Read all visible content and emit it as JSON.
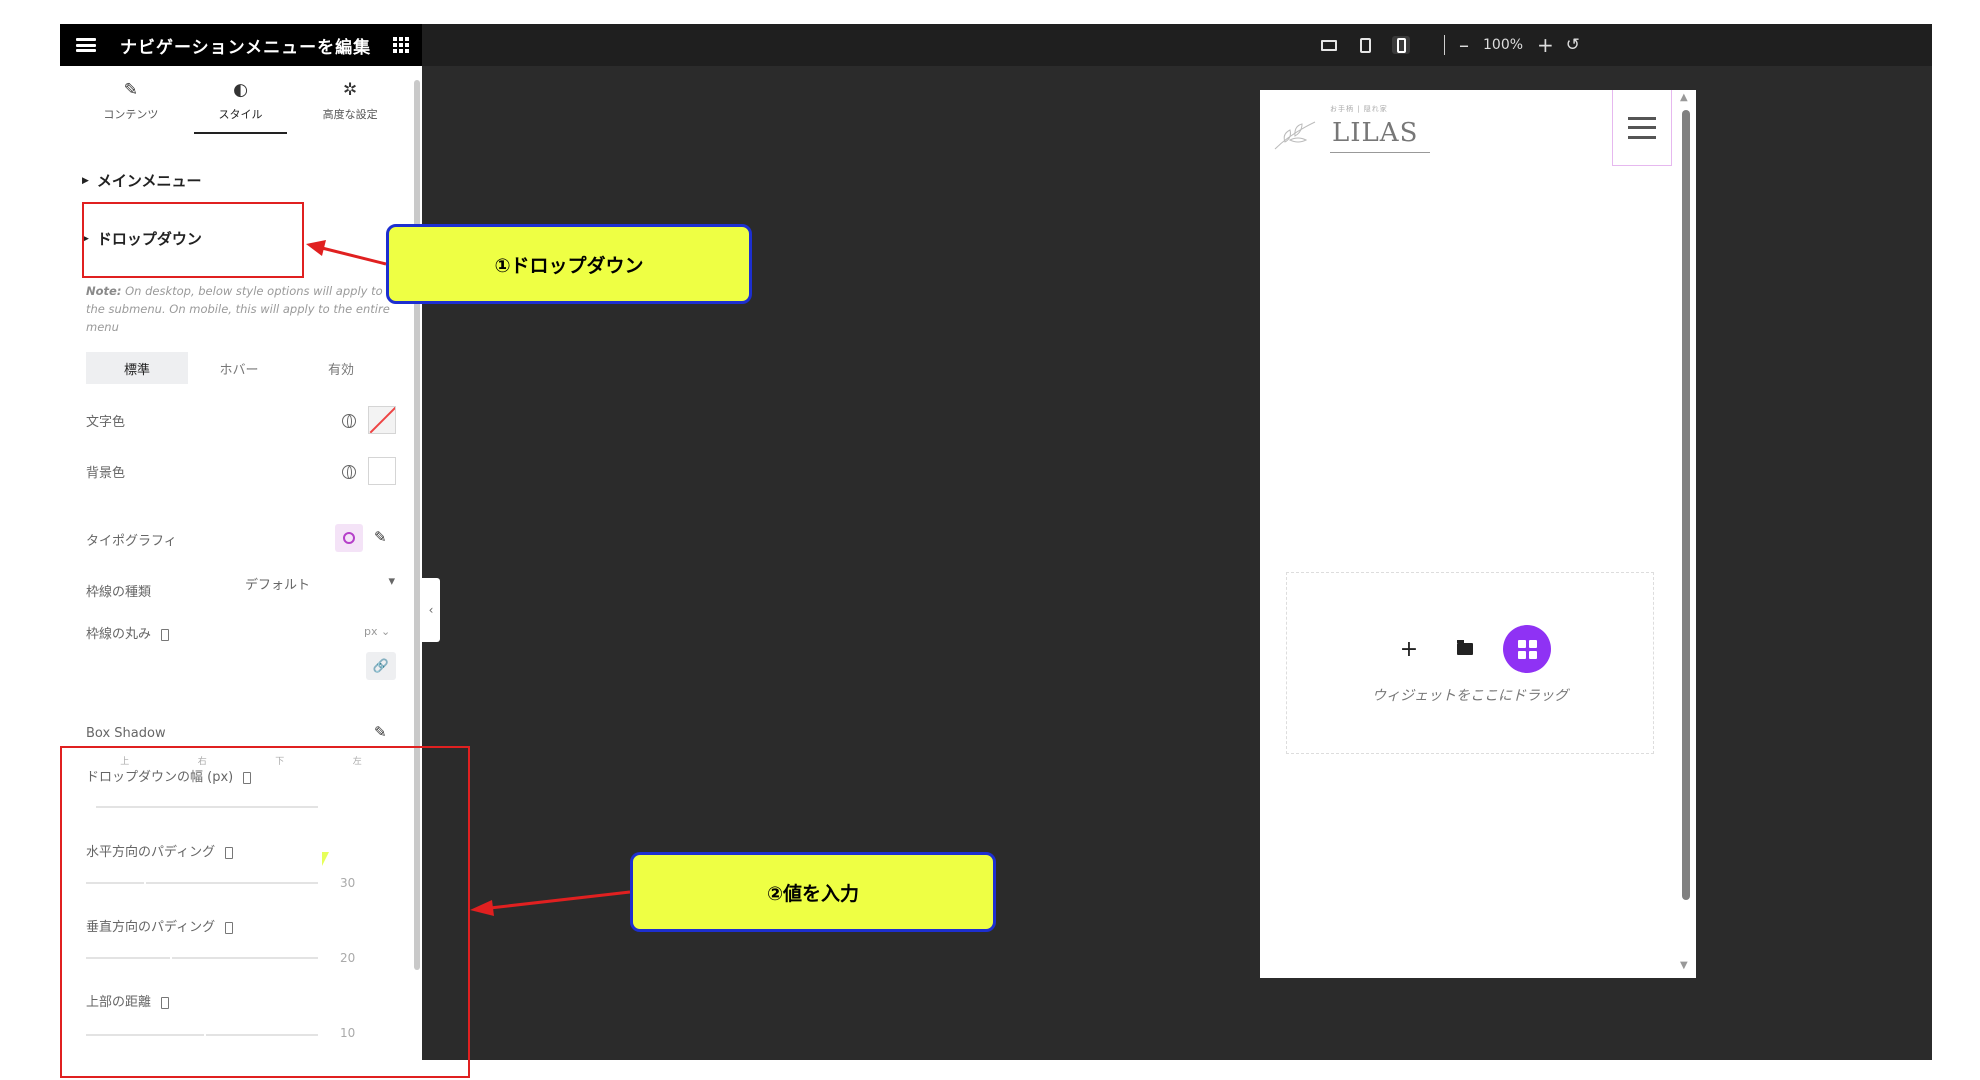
{
  "topbar": {
    "title": "ナビゲーションメニューを編集",
    "zoom_minus": "–",
    "zoom_value": "100%",
    "zoom_plus": "+",
    "reset_icon": "↺"
  },
  "panel": {
    "tabs": [
      {
        "icon": "✎",
        "label": "コンテンツ"
      },
      {
        "icon": "◐",
        "label": "スタイル"
      },
      {
        "icon": "✲",
        "label": "高度な設定"
      }
    ],
    "section_main_menu": "メインメニュー",
    "section_dropdown": "ドロップダウン",
    "note_label": "Note:",
    "note_text": " On desktop, below style options will apply to the submenu. On mobile, this will apply to the entire menu",
    "state_tabs": [
      "標準",
      "ホバー",
      "有効"
    ],
    "text_color_label": "文字色",
    "bg_color_label": "背景色",
    "typography_label": "タイポグラフィ",
    "border_type_label": "枠線の種類",
    "border_type_value": "デフォルト",
    "border_radius_label": "枠線の丸み",
    "border_radius_unit": "px ⌄",
    "dims": [
      "上",
      "右",
      "下",
      "左"
    ],
    "box_shadow_label": "Box Shadow",
    "dropdown_width_label": "ドロップダウンの幅 (px)",
    "h_padding_label": "水平方向のパディング",
    "h_padding_value": "30",
    "v_padding_label": "垂直方向のパディング",
    "v_padding_value": "20",
    "top_distance_label": "上部の距離",
    "top_distance_value": "10"
  },
  "preview": {
    "logo_small": "お手柄 | 隠れ家",
    "logo": "LILAS",
    "drop_text": "ウィジェットをここにドラッグ",
    "add_icon": "+"
  },
  "annotations": {
    "callout1": "①ドロップダウン",
    "callout2": "②値を入力"
  },
  "colors": {
    "accent_purple": "#8f32f4",
    "callout_fill": "#eeff44",
    "callout_border": "#1d2fd0",
    "highlight_red": "#e02020"
  }
}
